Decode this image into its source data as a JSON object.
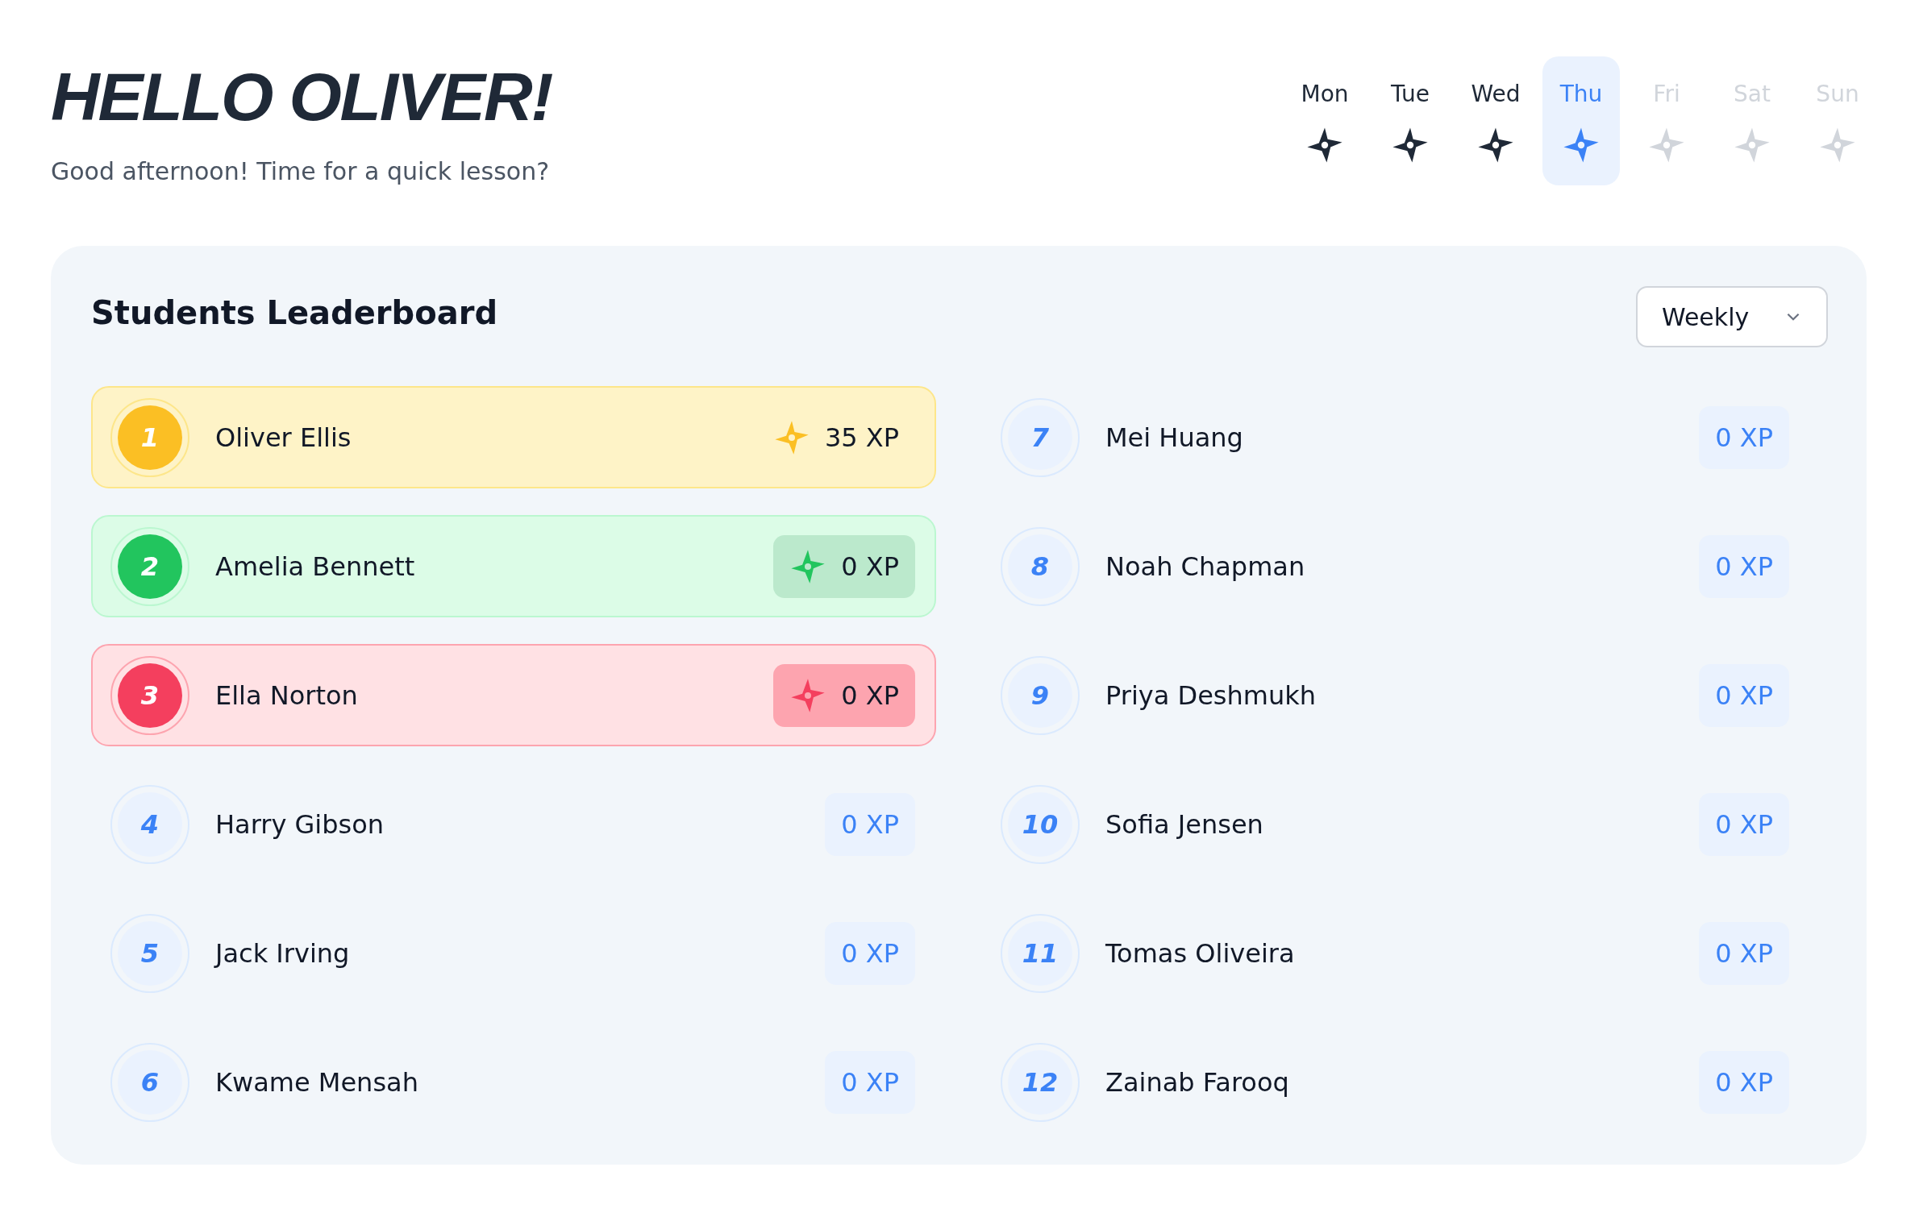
{
  "header": {
    "greeting": "HELLO OLIVER!",
    "subtitle": "Good afternoon! Time for a quick lesson?"
  },
  "week": [
    {
      "label": "Mon",
      "done": true,
      "selected": false
    },
    {
      "label": "Tue",
      "done": true,
      "selected": false
    },
    {
      "label": "Wed",
      "done": true,
      "selected": false
    },
    {
      "label": "Thu",
      "done": true,
      "selected": true
    },
    {
      "label": "Fri",
      "done": false,
      "selected": false
    },
    {
      "label": "Sat",
      "done": false,
      "selected": false
    },
    {
      "label": "Sun",
      "done": false,
      "selected": false
    }
  ],
  "leaderboard": {
    "title": "Students Leaderboard",
    "period": "Weekly",
    "rows": [
      {
        "rank": "1",
        "name": "Oliver Ellis",
        "xp": "35 XP",
        "kind": "gold"
      },
      {
        "rank": "2",
        "name": "Amelia Bennett",
        "xp": "0 XP",
        "kind": "green"
      },
      {
        "rank": "3",
        "name": "Ella Norton",
        "xp": "0 XP",
        "kind": "red"
      },
      {
        "rank": "4",
        "name": "Harry Gibson",
        "xp": "0 XP",
        "kind": "plain"
      },
      {
        "rank": "5",
        "name": "Jack Irving",
        "xp": "0 XP",
        "kind": "plain"
      },
      {
        "rank": "6",
        "name": "Kwame Mensah",
        "xp": "0 XP",
        "kind": "plain"
      },
      {
        "rank": "7",
        "name": "Mei Huang",
        "xp": "0 XP",
        "kind": "plain"
      },
      {
        "rank": "8",
        "name": "Noah Chapman",
        "xp": "0 XP",
        "kind": "plain"
      },
      {
        "rank": "9",
        "name": "Priya Deshmukh",
        "xp": "0 XP",
        "kind": "plain"
      },
      {
        "rank": "10",
        "name": "Sofia Jensen",
        "xp": "0 XP",
        "kind": "plain"
      },
      {
        "rank": "11",
        "name": "Tomas Oliveira",
        "xp": "0 XP",
        "kind": "plain"
      },
      {
        "rank": "12",
        "name": "Zainab Farooq",
        "xp": "0 XP",
        "kind": "plain"
      }
    ]
  }
}
